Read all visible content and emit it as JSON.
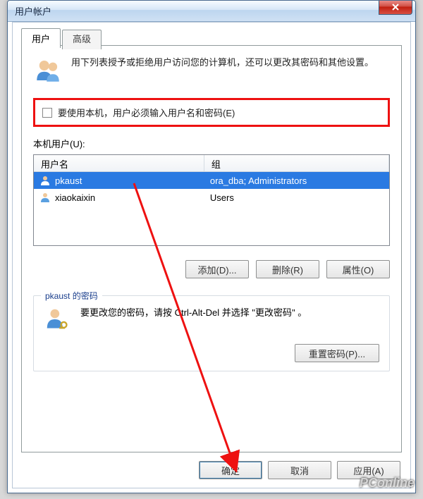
{
  "window": {
    "title": "用户帐户"
  },
  "tabs": {
    "user": "用户",
    "advanced": "高级"
  },
  "intro": "用下列表授予或拒绝用户访问您的计算机，还可以更改其密码和其他设置。",
  "checkbox_label": "要使用本机，用户必须输入用户名和密码(E)",
  "list_label": "本机用户(U):",
  "columns": {
    "name": "用户名",
    "group": "组"
  },
  "users": [
    {
      "name": "pkaust",
      "group": "ora_dba; Administrators",
      "selected": true
    },
    {
      "name": "xiaokaixin",
      "group": "Users",
      "selected": false
    }
  ],
  "buttons": {
    "add": "添加(D)...",
    "remove": "删除(R)",
    "props": "属性(O)",
    "reset": "重置密码(P)...",
    "ok": "确定",
    "cancel": "取消",
    "apply": "应用(A)"
  },
  "group": {
    "title": "pkaust 的密码",
    "text": "要更改您的密码，请按 Ctrl-Alt-Del 并选择 \"更改密码\" 。"
  },
  "watermark": "PConline"
}
